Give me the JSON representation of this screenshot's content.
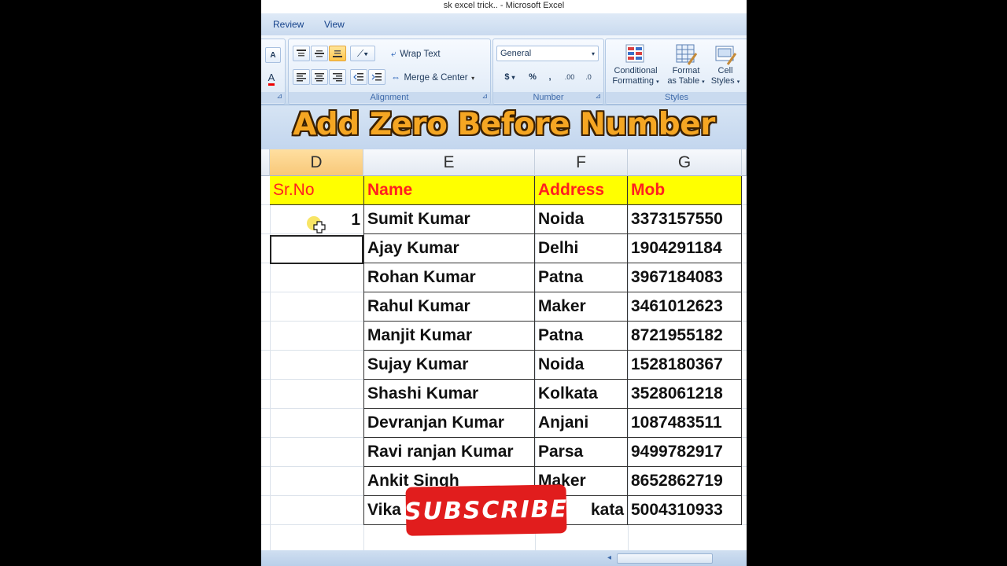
{
  "window": {
    "title": "sk excel trick.. - Microsoft Excel"
  },
  "ribbon": {
    "tabs": [
      "Review",
      "View"
    ],
    "font_group": {
      "grow_font": "A",
      "font_color": "A"
    },
    "alignment": {
      "wrap_text": "Wrap Text",
      "merge_center": "Merge & Center",
      "label": "Alignment"
    },
    "number": {
      "format": "General",
      "currency": "$",
      "percent": "%",
      "comma": ",",
      "increase_decimal": ".00",
      "decrease_decimal": ".0",
      "label": "Number"
    },
    "styles": {
      "conditional_formatting_1": "Conditional",
      "conditional_formatting_2": "Formatting",
      "format_table_1": "Format",
      "format_table_2": "as Table",
      "cell_styles_1": "Cell",
      "cell_styles_2": "Styles",
      "label": "Styles"
    }
  },
  "banner": {
    "text": "Add Zero Before Number"
  },
  "sheet": {
    "columns": [
      "D",
      "E",
      "F",
      "G"
    ],
    "headers": {
      "srno": "Sr.No",
      "name": "Name",
      "address": "Address",
      "mob": "Mob"
    },
    "rows": [
      {
        "srno": "1",
        "name": "Sumit Kumar",
        "address": "Noida",
        "mob": "3373157550"
      },
      {
        "srno": "",
        "name": "Ajay Kumar",
        "address": "Delhi",
        "mob": "1904291184"
      },
      {
        "srno": "",
        "name": "Rohan Kumar",
        "address": "Patna",
        "mob": "3967184083"
      },
      {
        "srno": "",
        "name": "Rahul Kumar",
        "address": "Maker",
        "mob": "3461012623"
      },
      {
        "srno": "",
        "name": "Manjit Kumar",
        "address": "Patna",
        "mob": "8721955182"
      },
      {
        "srno": "",
        "name": "Sujay Kumar",
        "address": "Noida",
        "mob": "1528180367"
      },
      {
        "srno": "",
        "name": "Shashi Kumar",
        "address": "Kolkata",
        "mob": "3528061218"
      },
      {
        "srno": "",
        "name": "Devranjan Kumar",
        "address": "Anjani",
        "mob": "1087483511"
      },
      {
        "srno": "",
        "name": "Ravi ranjan Kumar",
        "address": "Parsa",
        "mob": "9499782917"
      },
      {
        "srno": "",
        "name": "Ankit Singh",
        "address": "Maker",
        "mob": "8652862719"
      },
      {
        "srno": "",
        "name": "Vika",
        "address": "kata",
        "mob": "5004310933"
      }
    ]
  },
  "overlay": {
    "subscribe": "SUBSCRIBE"
  },
  "colors": {
    "header_fill": "#ffff00",
    "header_text": "#ff2020",
    "banner_text": "#f5a623",
    "subscribe_bg": "#e11d1d"
  }
}
